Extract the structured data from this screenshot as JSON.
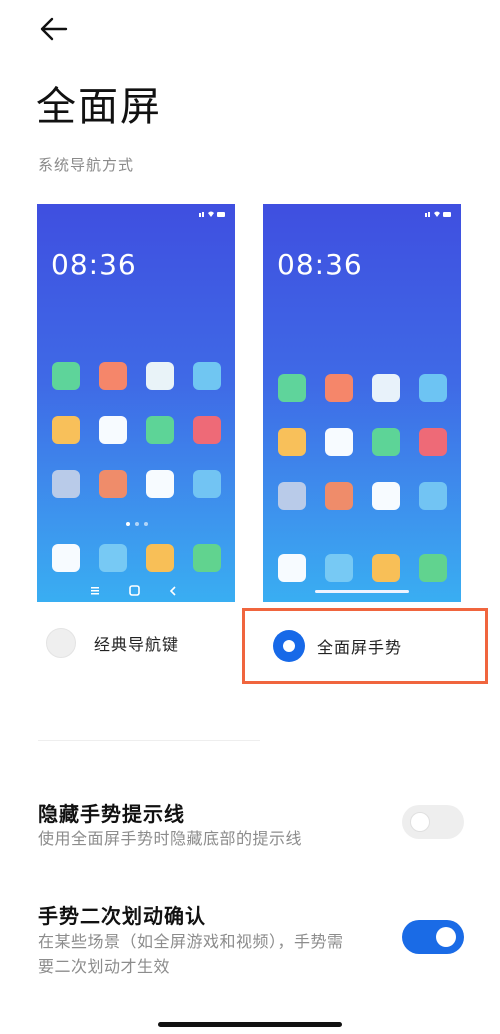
{
  "header": {
    "back_icon": "arrow-left-icon",
    "title": "全面屏"
  },
  "section_label": "系统导航方式",
  "phones": {
    "classic": {
      "time": "08:36"
    },
    "gesture": {
      "time": "08:36"
    }
  },
  "options": {
    "classic": {
      "label": "经典导航键",
      "selected": false
    },
    "gesture": {
      "label": "全面屏手势",
      "selected": true
    }
  },
  "settings": [
    {
      "title": "隐藏手势提示线",
      "description": "使用全面屏手势时隐藏底部的提示线",
      "enabled": false
    },
    {
      "title": "手势二次划动确认",
      "description_line1": "在某些场景（如全屏游戏和视频），手势需",
      "description_line2": "要二次划动才生效",
      "enabled": true
    }
  ],
  "colors": {
    "accent": "#1a6be6",
    "highlight_border": "#f0653e",
    "toggle_off": "#eeeeee"
  },
  "app_colors": {
    "classic": [
      "#5ed49a",
      "#f5866a",
      "#e9f3f8",
      "#70c6f2",
      "#f8c05a",
      "#f7fbff",
      "#5dd497",
      "#ee6a77",
      "#b9cbe9",
      "#ef8c6a",
      "#f7fbff",
      "#72c4f3",
      "#f7fbff",
      "#77c9f4",
      "#f8bf57",
      "#61d38f"
    ],
    "gesture": [
      "#5fd49b",
      "#f5866a",
      "#e8f2fa",
      "#6dc4f3",
      "#f8c05a",
      "#f7fbff",
      "#5dd497",
      "#ee6a77",
      "#b9cbe9",
      "#ef8c6a",
      "#f7fbff",
      "#72c4f3",
      "#f7fbff",
      "#77c9f4",
      "#f8bf57",
      "#61d38f"
    ]
  }
}
